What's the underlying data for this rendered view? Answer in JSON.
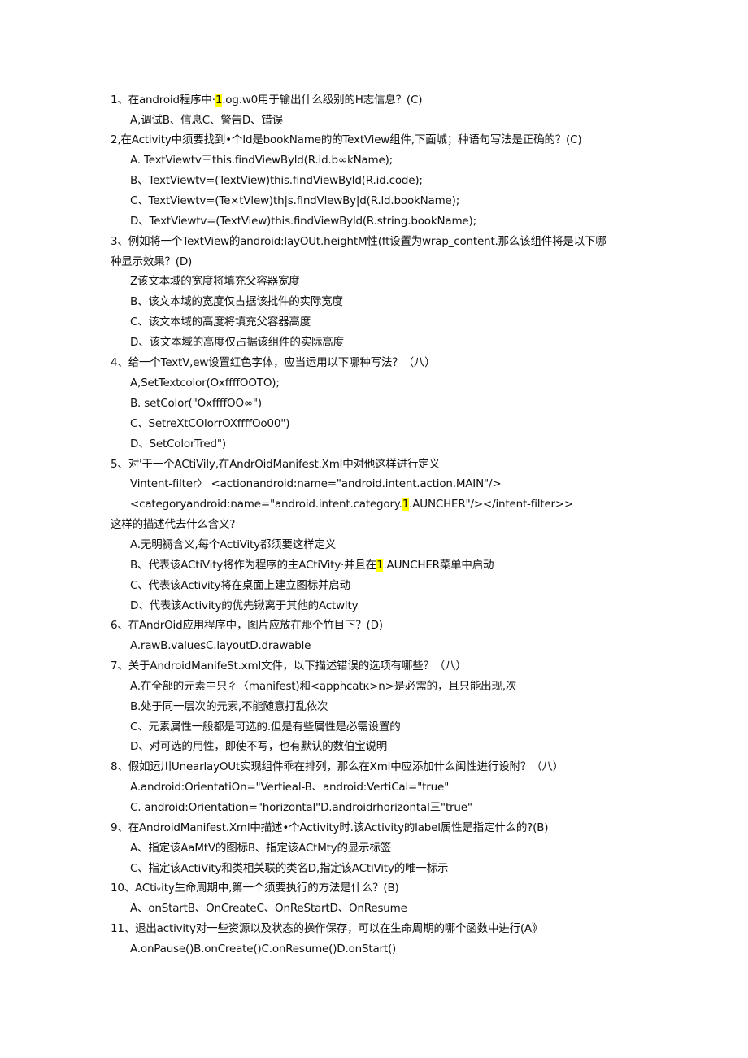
{
  "document": {
    "questions": [
      {
        "number": "1",
        "stem_parts": [
          "1、在android程序中·",
          "1",
          ".og.w0用于输出什么级别的H志信息？(C)"
        ],
        "options": [
          "A,调试B、信息C、警告D、错误"
        ]
      },
      {
        "number": "2",
        "stem": "2,在Activity中须要找到•个Id是bookName的的TextView组件,下面城；种语句写法是正确的？(C)",
        "options": [
          "A.    TextViewtv三this.findViewByld(R.id.b∞kName);",
          "B、TextViewtv=(TextView)this.findViewByld(R.id.code);",
          "C、TextViewtv=(Te×tVlew)th|s.flndVlewBy|d(R.ld.bookName);",
          "D、TextViewtv=(TextView)this.findViewByld(R.string.bookName);"
        ]
      },
      {
        "number": "3",
        "stem": "3、例如将一个TextView的android:layOUt.heightM性(ft设置为wrap_content.那么该组件将是以下哪",
        "stem_cont": "种显示效果？(D)",
        "options": [
          "Z该文本域的宽度将填充父容器宽度",
          "B、该文本域的宽度仅占据该批件的实际宽度",
          "C、该文本域的高度将填充父容器高度",
          "D、该文本域的高度仅占据该组件的实际高度"
        ]
      },
      {
        "number": "4",
        "stem": "4、给一个TextV,ew设置红色字体，应当运用以下哪种写法？（八）",
        "options": [
          "A,SetTextcolor(OxffffOOTO);",
          "B.    setColor(\"OxffffOO∞\")",
          "C、SetreXtCOlorrOXffffOo00\")",
          "D、SetColorTred\")"
        ]
      },
      {
        "number": "5",
        "stem": "5、对'于一个ACtiVily,在AndrOidManifest.Xml中对他这样进行定义",
        "code_lines": [
          "Vintent-filter〉    <actionandroid:name=\"android.intent.action.MAIN\"/>"
        ],
        "code_line2_parts": [
          "<categoryandroid:name=\"android.intent.category.",
          "1",
          ".AUNCHER\"/></intent-filter>>"
        ],
        "stem_cont": "这样的描述代去什么含义?",
        "options": [
          "A.无明褥含义,每个ActiVity都须要这样定义"
        ],
        "option_b_parts": [
          "B、代表该ACtiVity将作为程序的主ACtiVity·并且在",
          "1",
          ".AUNCHER菜单中启动"
        ],
        "options_rest": [
          "C、代表该Activity将在桌面上建立图标并启动",
          "D、代表该Activity的优先锹离于其他的Actwlty"
        ]
      },
      {
        "number": "6",
        "stem": "6、在AndrOid应用程序中，图片应放在那个竹目下？(D)",
        "options": [
          "A.rawB.valuesC.layoutD.drawable"
        ]
      },
      {
        "number": "7",
        "stem": "7、关于AndroidManifeSt.xml文件，以下描述错误的选项有哪些？（八）",
        "options": [
          "A.在全部的元素中只彳〈manifest)和<apphcatκ>n>是必需的，且只能出现,次",
          "B.处于同一层次的元素,不能随意打乱依次",
          "C、元素属性一般都是可选的.但是有些属性是必需设置的",
          "D、对可选的用性，即使不写，也有默认的数伯宝说明"
        ]
      },
      {
        "number": "8",
        "stem": "8、假如运川UnearlayOUt实现组件乖在排列，那么在Xml中应添加什么闽性进行设附？（八）",
        "options": [
          "A.android:OrientatiOn=\"Vertieal-B、android:VertiCal=\"true\"",
          "C.    android:Orientation=\"horizontal\"D.androidrhorizontal三\"true\""
        ]
      },
      {
        "number": "9",
        "stem": "9、在AndroidManifest.Xml中描述•个Activity时.该Activity的label属性是指定什么的?(B)",
        "options": [
          "A、指定该AaMtV的图标B、指定该ACtMty的显示标签",
          "C、指定该ActiVity和类相关联的类名D,指定该ACtiVity的唯一标示"
        ]
      },
      {
        "number": "10",
        "stem": "10、ACtiᵥity生命周期中,第一个须要执行的方法是什么？(B)",
        "options": [
          "A、onStartB、OnCreateC、OnReStartD、OnResume"
        ]
      },
      {
        "number": "11",
        "stem": "11、退出activity对一些资源以及状态的操作保存，可以在生命周期的哪个函数中进行(A》",
        "options": [
          "A.onPause()B.onCreate()C.onResume()D.onStart()"
        ]
      }
    ]
  },
  "colors": {
    "highlight": "#ffff00",
    "text": "#111111",
    "background": "#ffffff"
  }
}
